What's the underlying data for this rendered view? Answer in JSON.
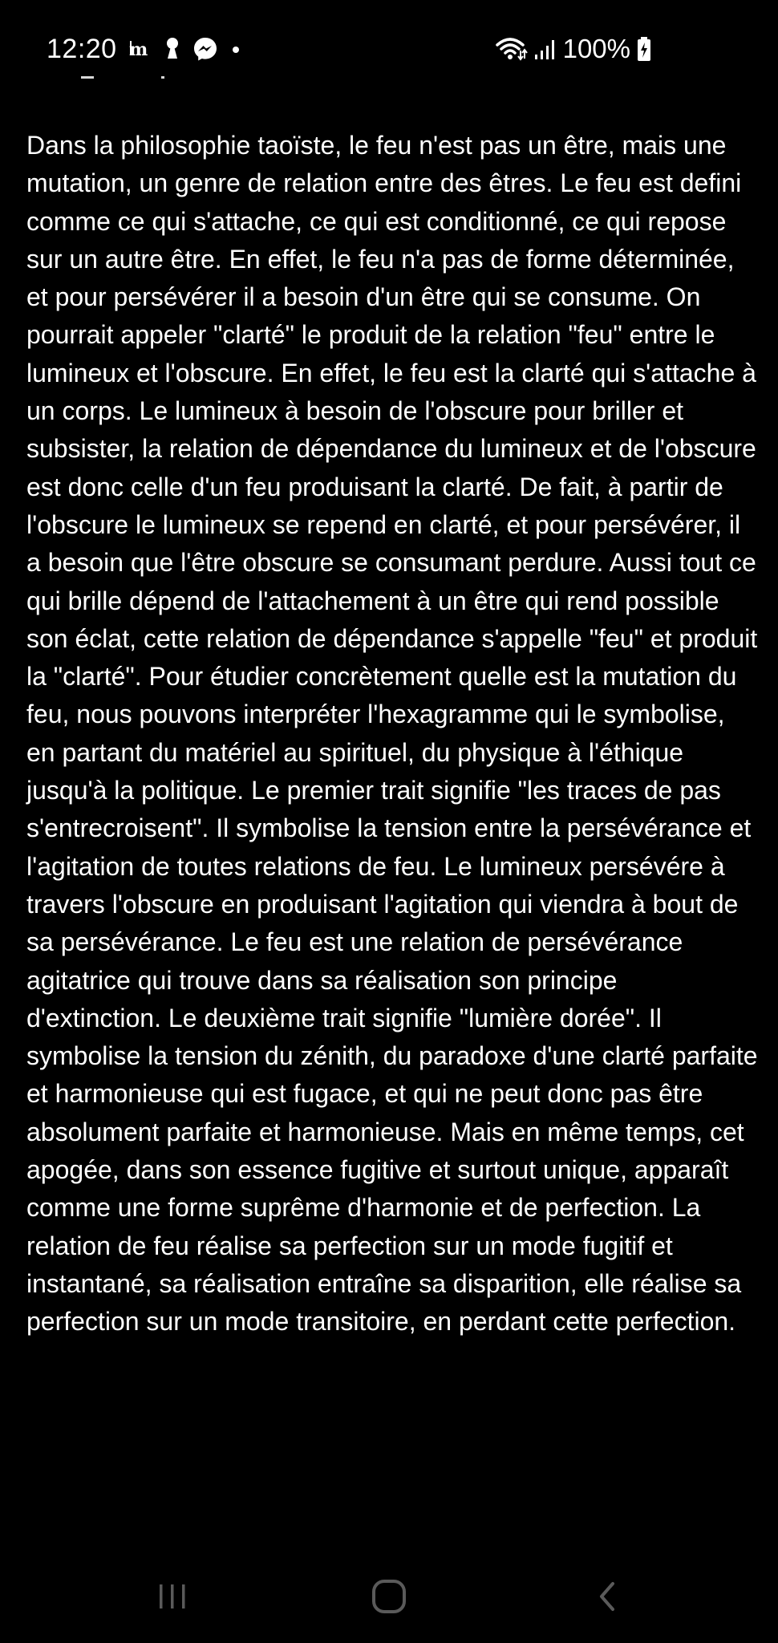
{
  "status_bar": {
    "time": "12:20",
    "battery": "100%",
    "notification_icons": [
      "newspaper-app-icon",
      "keyhole-icon",
      "messenger-icon",
      "dot-icon"
    ],
    "system_icons": [
      "wifi-icon",
      "signal-icon",
      "battery-charging-icon"
    ]
  },
  "article": {
    "body": "Dans la philosophie taoïste, le feu n'est pas un être, mais une mutation, un genre de relation entre des êtres. Le feu est defini comme ce qui s'attache, ce qui est conditionné, ce qui repose sur un autre être. En effet, le feu n'a pas de forme déterminée, et pour persévérer il a besoin d'un être qui se consume. On pourrait appeler \"clarté\" le produit de la relation \"feu\" entre le lumineux et l'obscure. En effet, le feu est la clarté qui s'attache à un corps. Le lumineux à besoin de l'obscure pour briller et subsister, la relation de dépendance du lumineux et de l'obscure est donc celle d'un feu produisant la clarté. De fait, à partir de l'obscure le lumineux se repend en clarté, et pour persévérer, il a besoin que l'être obscure se consumant perdure. Aussi tout ce qui brille dépend de l'attachement à un être qui rend possible son éclat, cette relation de dépendance s'appelle \"feu\" et produit la \"clarté\". Pour étudier concrètement quelle est la mutation du feu, nous pouvons interpréter l'hexagramme qui le symbolise, en partant du matériel au spirituel, du physique à l'éthique jusqu'à la politique. Le premier trait signifie \"les traces de pas s'entrecroisent\". Il symbolise la tension entre la persévérance et l'agitation de toutes relations de feu. Le lumineux persévére à travers l'obscure en produisant l'agitation qui viendra à bout de sa persévérance. Le feu est une relation de persévérance agitatrice qui trouve dans sa réalisation son principe d'extinction. Le deuxième trait signifie \"lumière dorée\". Il symbolise la tension du zénith, du paradoxe d'une clarté parfaite et harmonieuse qui est fugace, et qui ne peut donc pas être absolument parfaite et harmonieuse. Mais en même temps, cet apogée, dans son essence fugitive et surtout unique, apparaît comme une forme suprême d'harmonie et de perfection. La relation de feu réalise sa perfection sur un mode fugitif et instantané, sa réalisation entraîne sa disparition, elle réalise sa perfection sur un mode transitoire, en perdant cette perfection."
  },
  "navigation_bar": {
    "buttons": [
      "recent-apps-icon",
      "home-icon",
      "back-icon"
    ]
  }
}
